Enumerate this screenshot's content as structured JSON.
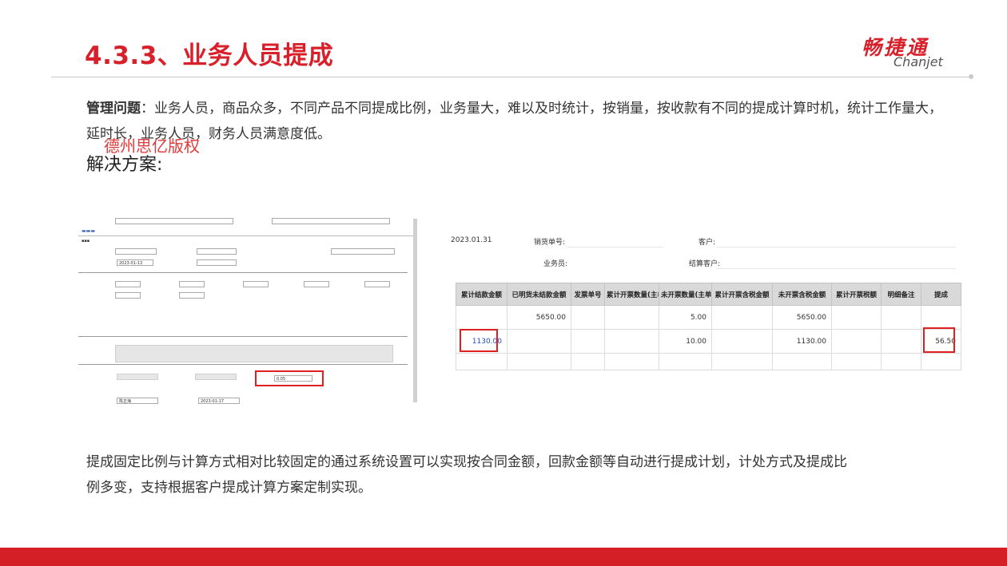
{
  "header": {
    "title": "4.3.3、业务人员提成",
    "logo_cn": "畅捷通",
    "logo_en": "Chanjet"
  },
  "problem": {
    "label": "管理问题",
    "text": "：业务人员，商品众多，不同产品不同提成比例，业务量大，难以及时统计，按销量，按收款有不同的提成计算时机，统计工作量大，延时长，业务人员，财务人员满意度低。"
  },
  "watermark": "德州思亿版权",
  "solution_label": "解决方案:",
  "form_screenshot": {
    "input_date": "2023-01-13",
    "input_commission_rate": "0.05",
    "input_maker": "陈正海",
    "input_make_date": "2023-01-17"
  },
  "table_screenshot": {
    "date": "2023.01.31",
    "sales_no_label": "销货单号:",
    "customer_label": "客户:",
    "salesperson_label": "业务员:",
    "settle_customer_label": "结算客户:",
    "columns": [
      "累计结款金额",
      "已明货未结款金额",
      "发票单号",
      "累计开票数量(主单位)",
      "未开票数量(主单位)",
      "累计开票含税金额",
      "未开票含税金额",
      "累计开票税额",
      "明细备注",
      "提成"
    ],
    "rows": [
      [
        "",
        "5650.00",
        "",
        "",
        "5.00",
        "",
        "5650.00",
        "",
        "",
        ""
      ],
      [
        "1130.00",
        "",
        "",
        "",
        "10.00",
        "",
        "1130.00",
        "",
        "",
        "56.50"
      ],
      [
        "",
        "",
        "",
        "",
        "",
        "",
        "",
        "",
        "",
        ""
      ]
    ]
  },
  "bottom_text": "提成固定比例与计算方式相对比较固定的通过系统设置可以实现按合同金额，回款金额等自动进行提成计划，计处方式及提成比例多变，支持根据客户提成计算方案定制实现。",
  "colors": {
    "brand_red": "#d8202a",
    "footer_red": "#d51f27",
    "highlight_box": "#e02020"
  }
}
